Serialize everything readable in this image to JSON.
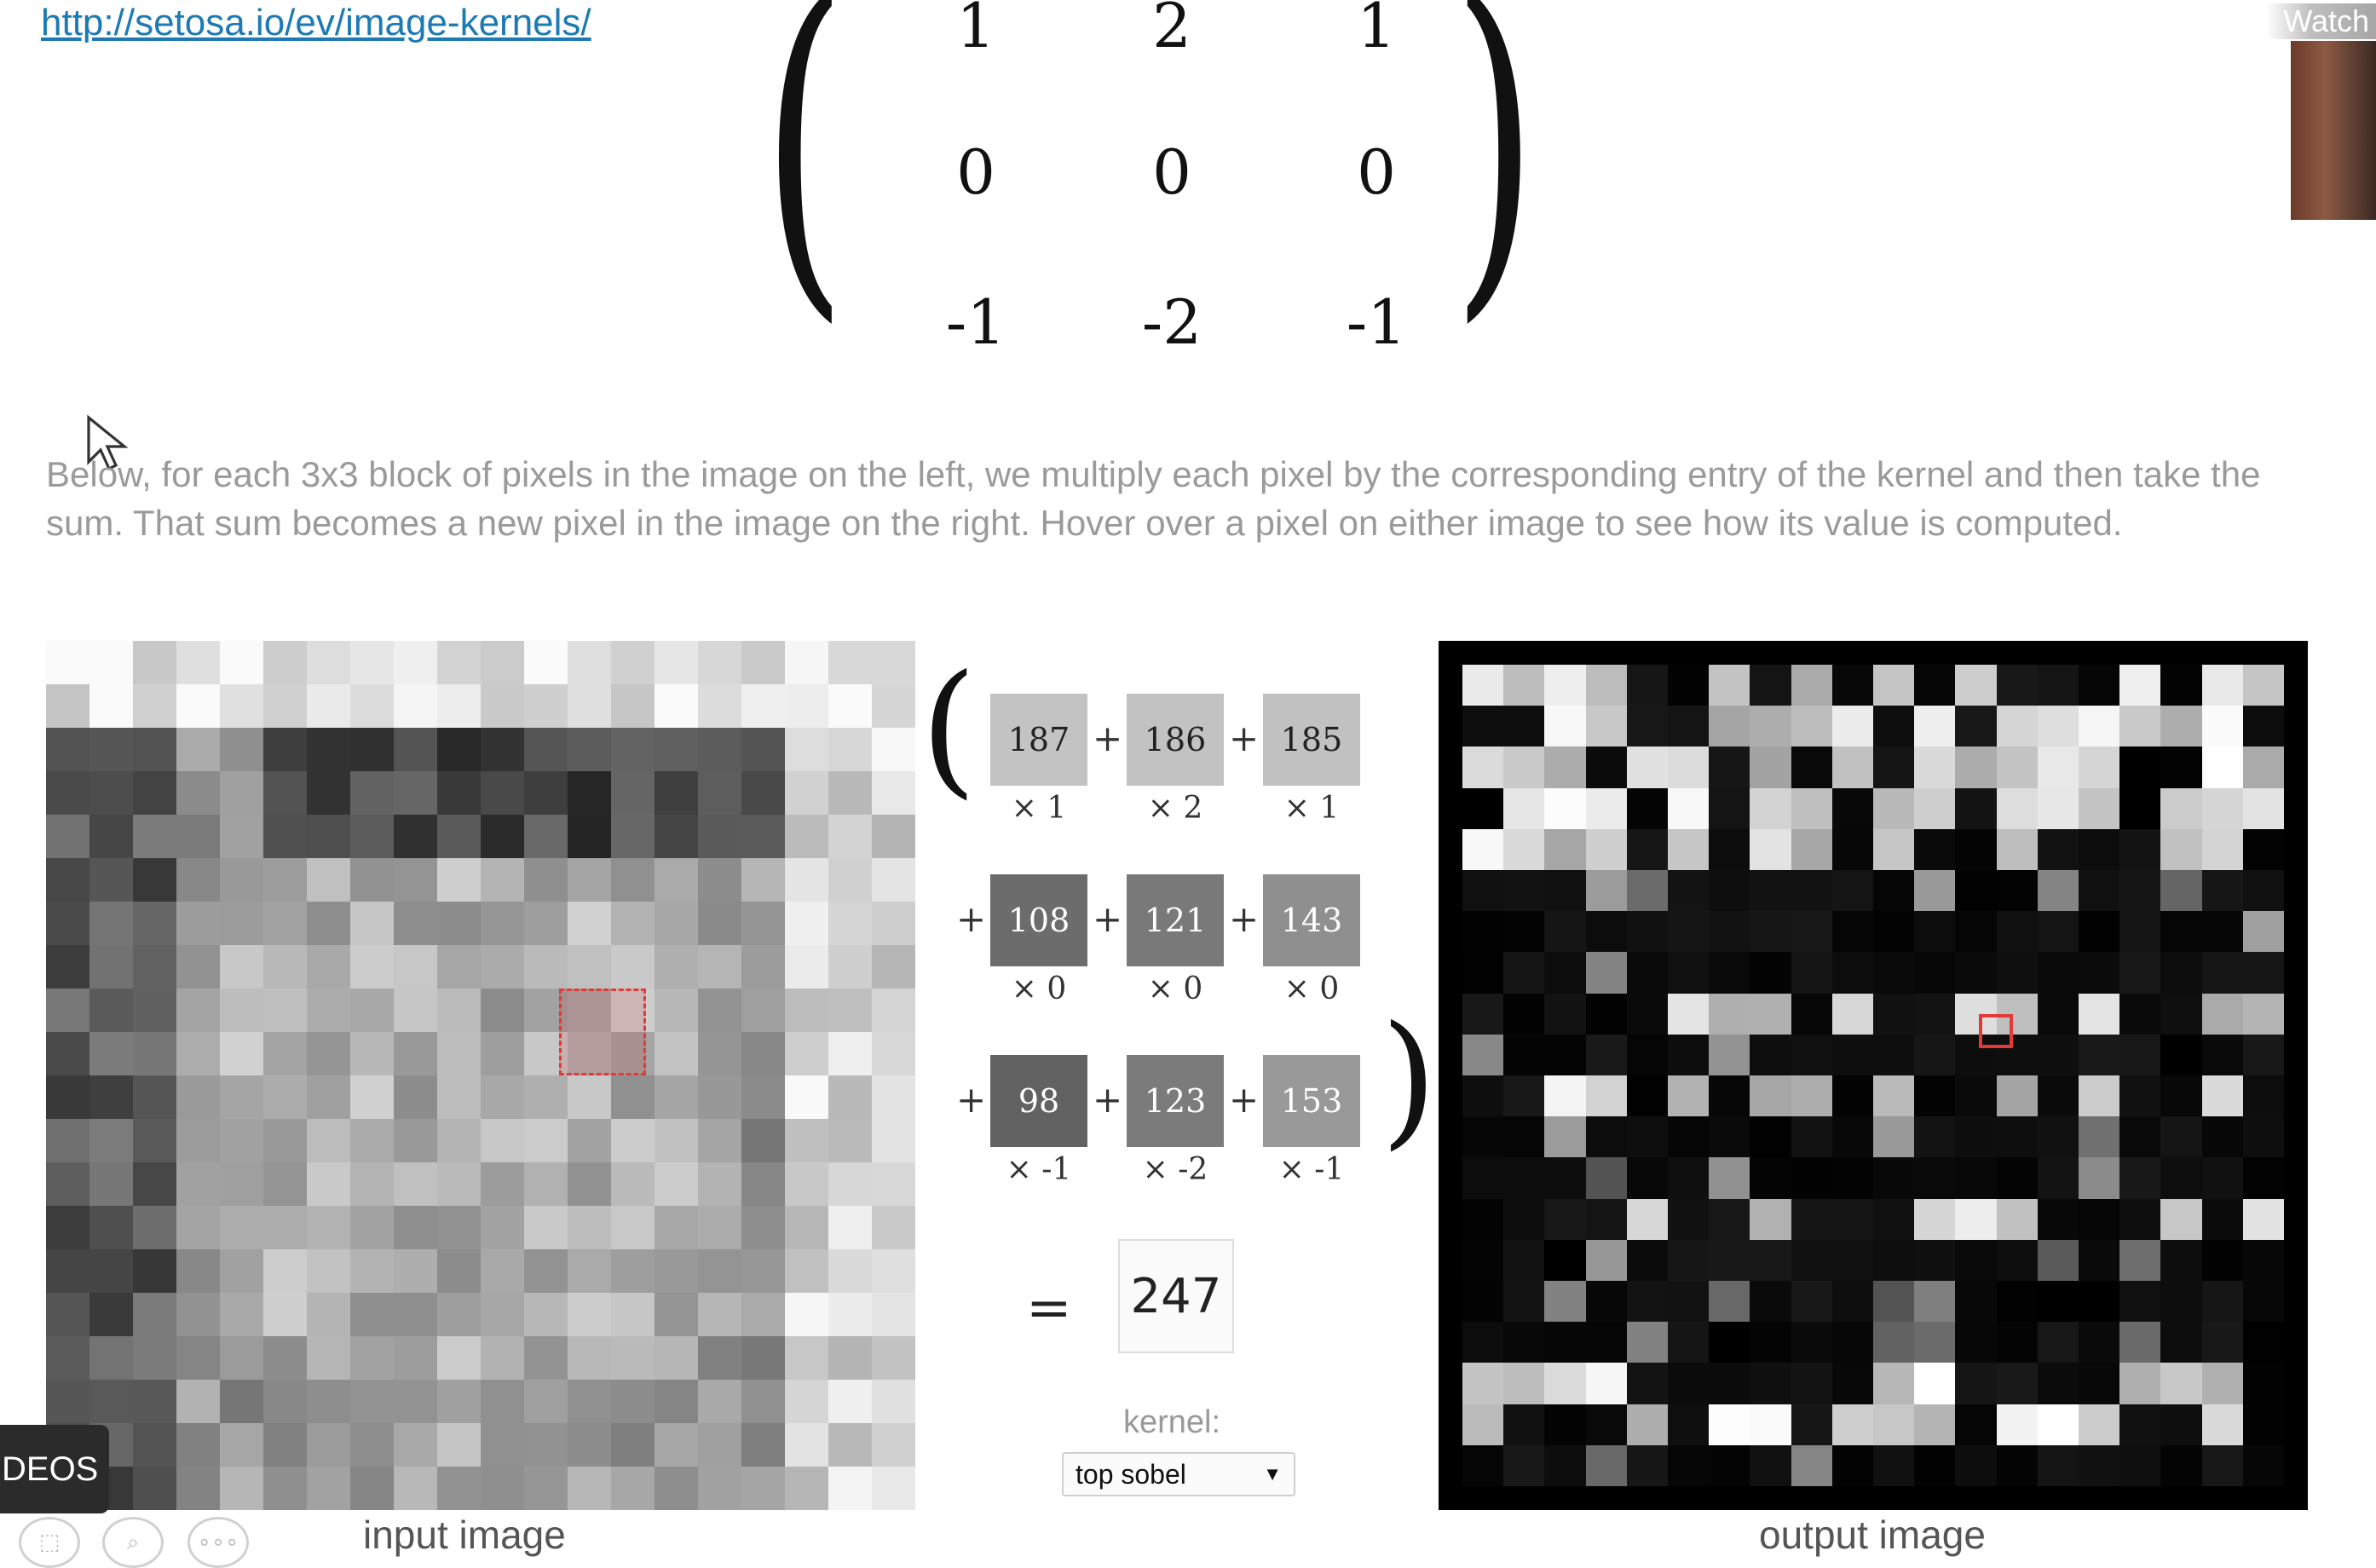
{
  "header": {
    "url_text": "http://setosa.io/ev/image-kernels/",
    "watch_label": "Watch"
  },
  "kernel_matrix": [
    [
      "1",
      "2",
      "1"
    ],
    [
      "0",
      "0",
      "0"
    ],
    [
      "-1",
      "-2",
      "-1"
    ]
  ],
  "description": "Below, for each 3x3 block of pixels in the image on the left, we multiply each pixel by the corresponding entry of the kernel and then take the sum. That sum becomes a new pixel in the image on the right. Hover over a pixel on either image to see how its value is computed.",
  "calculation": {
    "pixel_values": [
      "187",
      "186",
      "185",
      "108",
      "121",
      "143",
      "98",
      "123",
      "153"
    ],
    "multipliers": [
      "× 1",
      "× 2",
      "× 1",
      "× 0",
      "× 0",
      "× 0",
      "× -1",
      "× -2",
      "× -1"
    ],
    "plus": "+",
    "equals": "=",
    "result": "247"
  },
  "kernel_selector": {
    "label": "kernel:",
    "selected": "top sobel",
    "arrow": "▼"
  },
  "labels": {
    "input": "input image",
    "output": "output image"
  },
  "overlay": {
    "videos_badge": "DEOS",
    "button_icons": [
      "⬚",
      "⌕",
      "∘∘∘"
    ]
  },
  "colors": {
    "link": "#1c7ab5",
    "highlight": "#e23a3a",
    "description_text": "#9a9a9a"
  }
}
